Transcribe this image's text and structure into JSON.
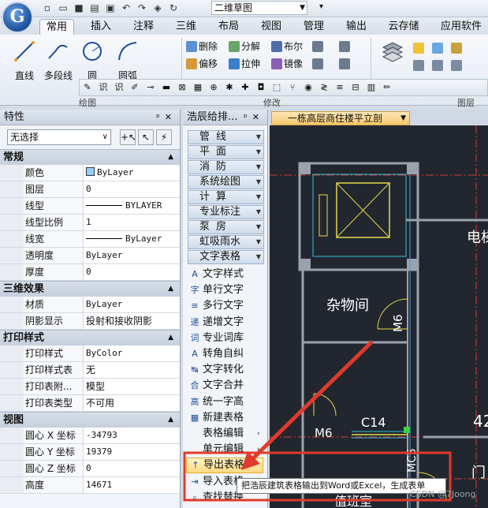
{
  "quick_access": {
    "icons": [
      "new-file-icon",
      "open-folder-icon",
      "save-icon",
      "save-as-icon",
      "print-icon",
      "undo-icon",
      "redo-icon",
      "layers-icon",
      "refresh-icon"
    ],
    "workspace": "二维草图"
  },
  "ribbon": {
    "tabs": [
      "常用",
      "插入",
      "注释",
      "三维",
      "布局",
      "视图",
      "管理",
      "输出",
      "云存储",
      "应用软件"
    ],
    "active_tab": "常用",
    "draw_tools": [
      "直线",
      "多段线",
      "圆",
      "圆弧"
    ],
    "modify_tools": [
      {
        "label": "删除",
        "icon": "erase-icon"
      },
      {
        "label": "分解",
        "icon": "explode-icon"
      },
      {
        "label": "布尔",
        "icon": "boolean-icon"
      },
      {
        "label": "偏移",
        "icon": "offset-icon"
      },
      {
        "label": "拉伸",
        "icon": "stretch-icon"
      },
      {
        "label": "镜像",
        "icon": "mirror-icon"
      }
    ],
    "layer_tool": "图层",
    "group_labels": [
      "绘图",
      "修改",
      "图层"
    ]
  },
  "properties_panel": {
    "title": "特性",
    "selection": "无选择",
    "groups": [
      {
        "name": "常规",
        "rows": [
          {
            "key": "颜色",
            "value": "ByLayer",
            "kind": "color"
          },
          {
            "key": "图层",
            "value": "0"
          },
          {
            "key": "线型",
            "value": "BYLAYER",
            "kind": "line"
          },
          {
            "key": "线型比例",
            "value": "1"
          },
          {
            "key": "线宽",
            "value": "ByLayer",
            "kind": "line"
          },
          {
            "key": "透明度",
            "value": "ByLayer"
          },
          {
            "key": "厚度",
            "value": "0"
          }
        ]
      },
      {
        "name": "三维效果",
        "rows": [
          {
            "key": "材质",
            "value": "ByLayer"
          },
          {
            "key": "阴影显示",
            "value": "投射和接收阴影"
          }
        ]
      },
      {
        "name": "打印样式",
        "rows": [
          {
            "key": "打印样式",
            "value": "ByColor"
          },
          {
            "key": "打印样式表",
            "value": "无"
          },
          {
            "key": "打印表附...",
            "value": "模型"
          },
          {
            "key": "打印表类型",
            "value": "不可用"
          }
        ]
      },
      {
        "name": "视图",
        "rows": [
          {
            "key": "圆心 X 坐标",
            "value": "-34793"
          },
          {
            "key": "圆心 Y 坐标",
            "value": "19379"
          },
          {
            "key": "圆心 Z 坐标",
            "value": "0"
          },
          {
            "key": "高度",
            "value": "14671"
          }
        ]
      }
    ]
  },
  "tool_panel": {
    "title": "浩辰给排...",
    "categories": [
      "管线",
      "平面",
      "消防",
      "系统绘图",
      "计算",
      "专业标注",
      "泵房",
      "虹吸雨水",
      "文字表格"
    ],
    "subitems": [
      {
        "label": "文字样式",
        "icon": "text-style-icon"
      },
      {
        "label": "单行文字",
        "icon": "single-text-icon"
      },
      {
        "label": "多行文字",
        "icon": "multi-text-icon"
      },
      {
        "label": "递增文字",
        "icon": "increment-text-icon"
      },
      {
        "label": "专业词库",
        "icon": "dictionary-icon"
      },
      {
        "label": "转角自纠",
        "icon": "angle-fix-icon"
      },
      {
        "label": "文字转化",
        "icon": "text-convert-icon"
      },
      {
        "label": "文字合并",
        "icon": "text-merge-icon"
      },
      {
        "label": "统一字高",
        "icon": "text-height-icon"
      },
      {
        "label": "新建表格",
        "icon": "new-table-icon"
      },
      {
        "label": "表格编辑",
        "icon": "table-edit-icon",
        "submenu": true
      },
      {
        "label": "单元编辑",
        "icon": "cell-edit-icon",
        "submenu": true
      },
      {
        "label": "导出表格",
        "icon": "export-table-icon",
        "highlighted": true
      },
      {
        "label": "导入表格",
        "icon": "import-table-icon"
      },
      {
        "label": "查找替换",
        "icon": "find-replace-icon"
      }
    ]
  },
  "document": {
    "tab": "一栋高层商住楼平立剖",
    "labels": [
      "杂物间",
      "电梯",
      "M6",
      "M6",
      "C14",
      "MC5",
      "42",
      "门",
      "值班室"
    ]
  },
  "tooltip": "把浩辰建筑表格输出到Word或Excel，生成表单",
  "watermark": "CSDN @7Joong",
  "colors": {
    "highlight": "#ffd980",
    "annotation": "#e03a2c",
    "canvas": "#22272f"
  }
}
